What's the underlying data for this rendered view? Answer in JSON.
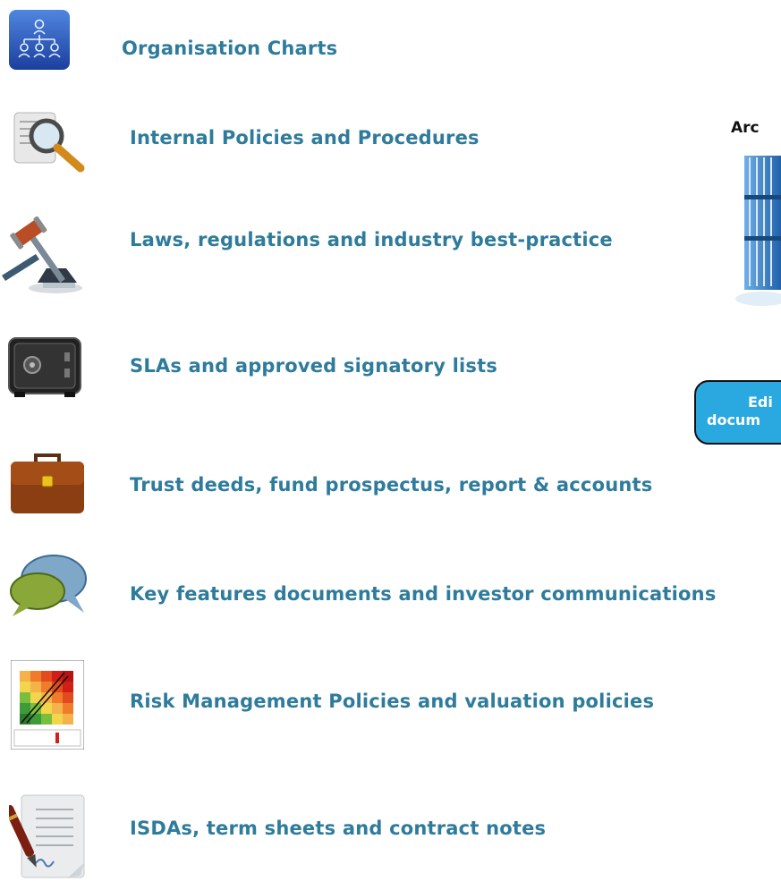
{
  "items": [
    {
      "label": "Organisation Charts",
      "icon": "org-chart-icon"
    },
    {
      "label": "Internal Policies and Procedures",
      "icon": "magnifier-document-icon"
    },
    {
      "label": "Laws, regulations and industry best-practice",
      "icon": "gavel-icon"
    },
    {
      "label": "SLAs and approved signatory lists",
      "icon": "safe-icon"
    },
    {
      "label": "Trust deeds, fund prospectus, report & accounts",
      "icon": "briefcase-icon"
    },
    {
      "label": "Key features documents and investor communications",
      "icon": "speech-bubbles-icon"
    },
    {
      "label": "Risk Management Policies and valuation policies",
      "icon": "risk-heatmap-icon"
    },
    {
      "label": "ISDAs, term sheets and contract notes",
      "icon": "contract-pen-icon"
    }
  ],
  "archive": {
    "label": "Arc",
    "icon": "archive-binders-icon"
  },
  "edit_button": {
    "line1": "Edi",
    "line2": "docum"
  },
  "colors": {
    "label": "#2e7b9c",
    "button": "#2aa8e0"
  }
}
